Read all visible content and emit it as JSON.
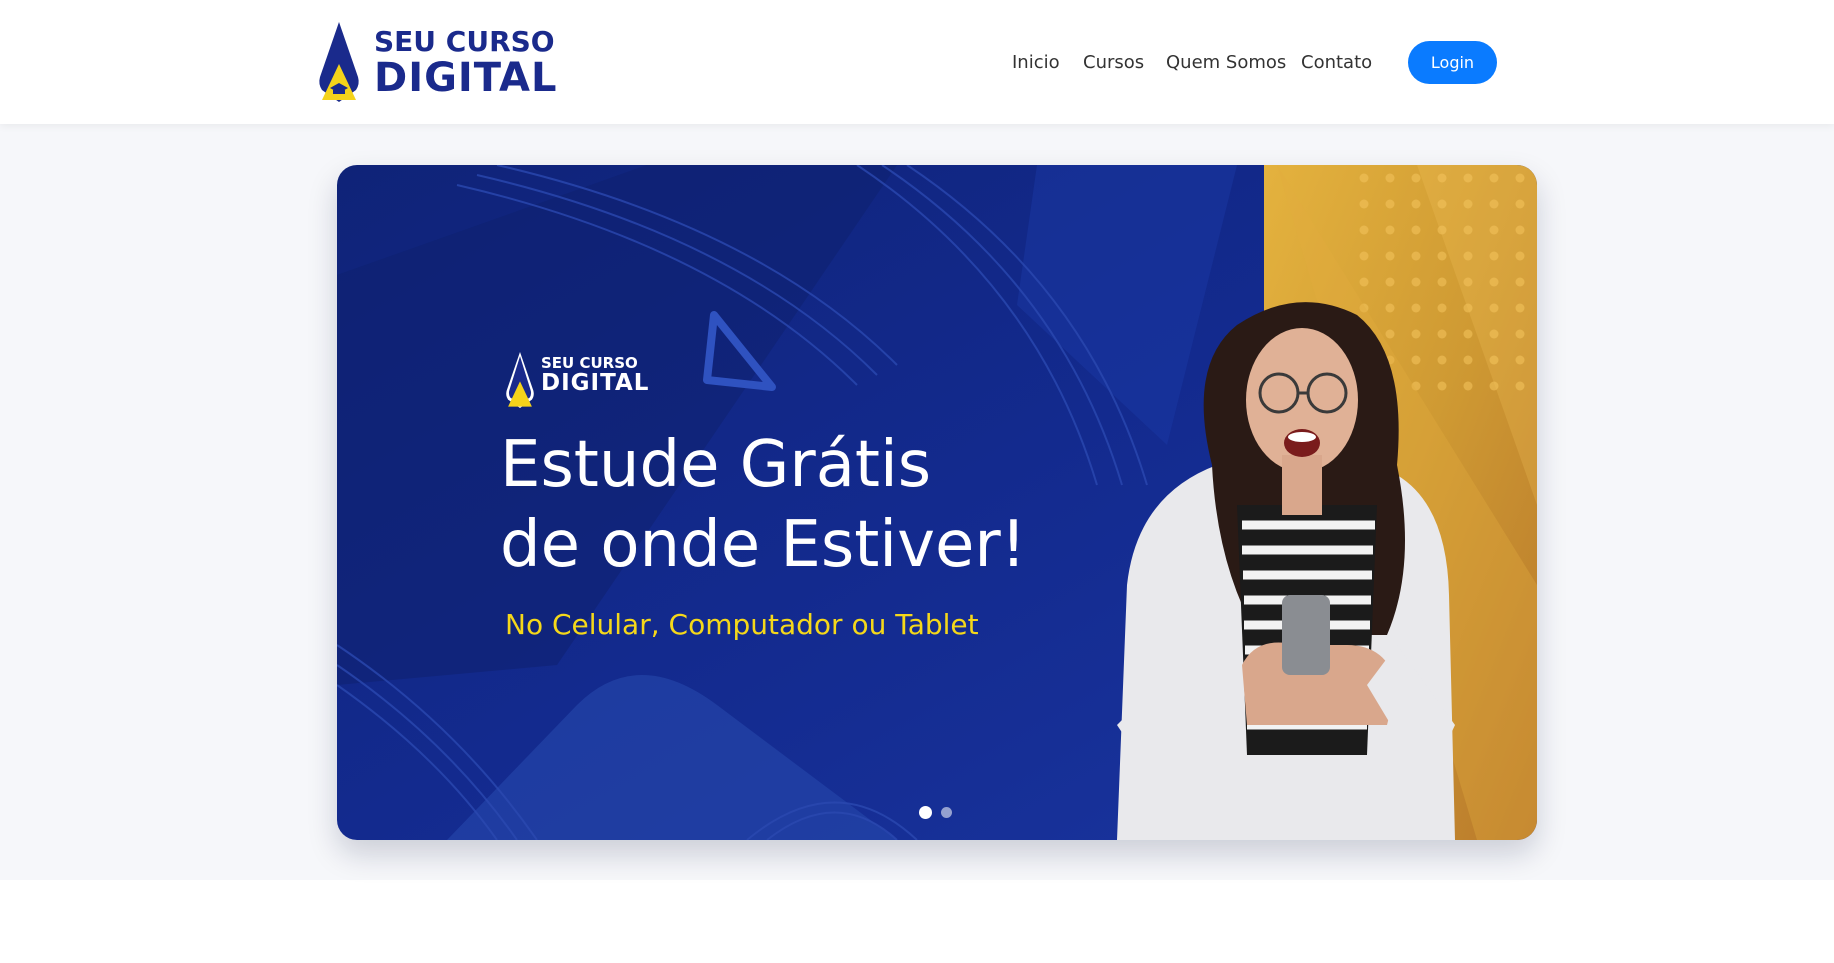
{
  "brand": {
    "line1": "SEU CURSO",
    "line2": "DIGITAL",
    "logo_icon": "drop-graduation-cap-icon"
  },
  "nav": {
    "items": [
      "Inicio",
      "Cursos",
      "Quem Somos",
      "Contato"
    ],
    "login_label": "Login"
  },
  "hero": {
    "logo_line1": "SEU CURSO",
    "logo_line2": "DIGITAL",
    "headline_line1": "Estude Grátis",
    "headline_line2": "de onde Estiver!",
    "subheadline": "No Celular, Computador ou Tablet",
    "slide_count": 2,
    "active_slide": 1
  },
  "colors": {
    "brand_blue": "#1a2a8c",
    "banner_blue": "#13288a",
    "banner_gold": "#d9a23a",
    "accent_yellow": "#f5d81a",
    "login_blue": "#0a7bff"
  }
}
